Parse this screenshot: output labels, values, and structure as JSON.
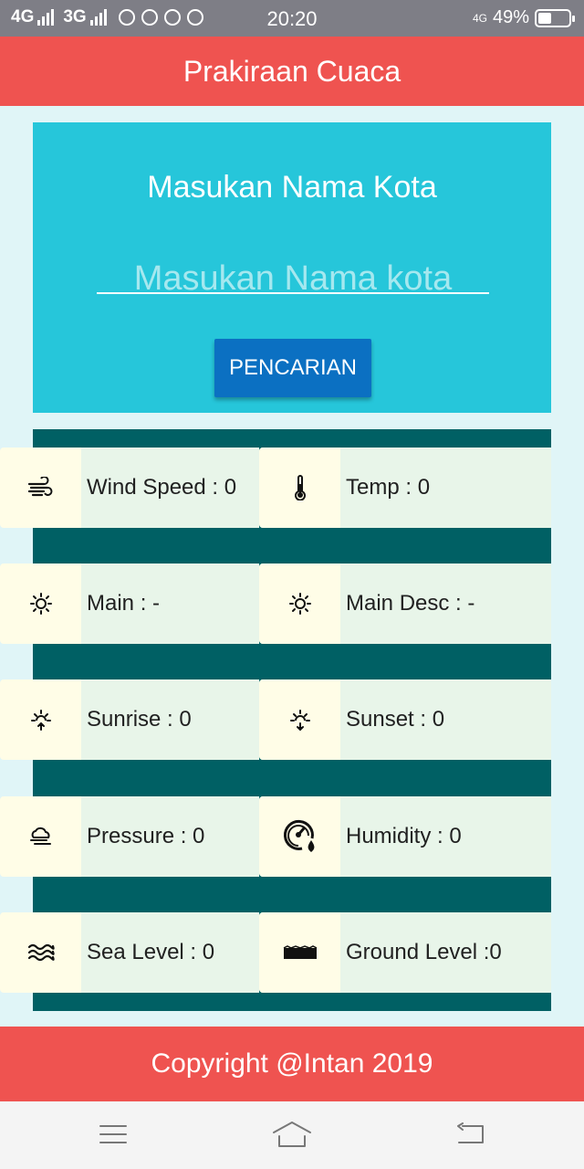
{
  "status_bar": {
    "network1": "4G",
    "network2": "3G",
    "time": "20:20",
    "lte": "4G",
    "battery_percent": "49%"
  },
  "app_bar": {
    "title": "Prakiraan Cuaca"
  },
  "search": {
    "title": "Masukan Nama Kota",
    "placeholder": "Masukan Nama kota",
    "value": "",
    "button_label": "PENCARIAN"
  },
  "weather": {
    "wind_speed": "Wind Speed : 0",
    "temp": "Temp : 0",
    "main": "Main : -",
    "main_desc": "Main Desc : -",
    "sunrise": "Sunrise : 0",
    "sunset": "Sunset : 0",
    "pressure": "Pressure : 0",
    "humidity": "Humidity : 0",
    "sea_level": "Sea Level : 0",
    "ground_level": "Ground Level :0"
  },
  "footer": {
    "text": "Copyright @Intan 2019"
  },
  "colors": {
    "accent_red": "#ef5350",
    "search_bg": "#26c6da",
    "panel_bg": "#006064",
    "button_bg": "#0b70c2"
  }
}
